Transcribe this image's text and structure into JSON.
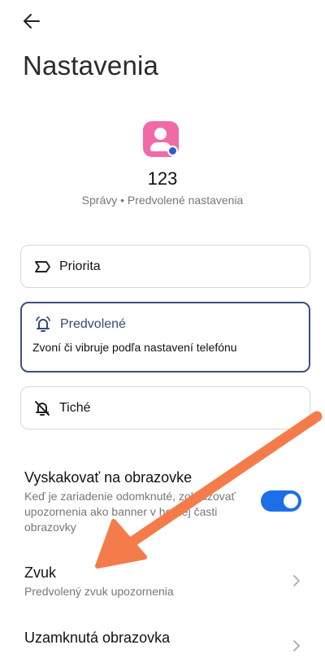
{
  "header": {
    "title": "Nastavenia",
    "back_icon": "arrow-left-icon"
  },
  "app": {
    "name": "123",
    "subtitle": "Správy • Predvolené nastavenia",
    "icon": "contact-icon",
    "icon_color": "#f06aa8"
  },
  "options": {
    "priority": {
      "label": "Priorita",
      "icon": "priority-icon"
    },
    "default": {
      "label": "Predvolené",
      "description": "Zvoní či vibruje podľa nastavení telefónu",
      "icon": "bell-icon",
      "selected": true
    },
    "silent": {
      "label": "Tiché",
      "icon": "bell-off-icon"
    }
  },
  "settings": {
    "popup": {
      "title": "Vyskakovať na obrazovke",
      "description": "Keď je zariadenie odomknuté, zobrazovať upozornenia ako banner v hornej časti obrazovky",
      "enabled": true
    },
    "sound": {
      "title": "Zvuk",
      "description": "Predvolený zvuk upozornenia"
    },
    "lockscreen": {
      "title": "Uzamknutá obrazovka"
    }
  },
  "colors": {
    "accent": "#1d6fe8",
    "selected_border": "#3d4f79",
    "annotation_arrow": "#f47c4a"
  }
}
